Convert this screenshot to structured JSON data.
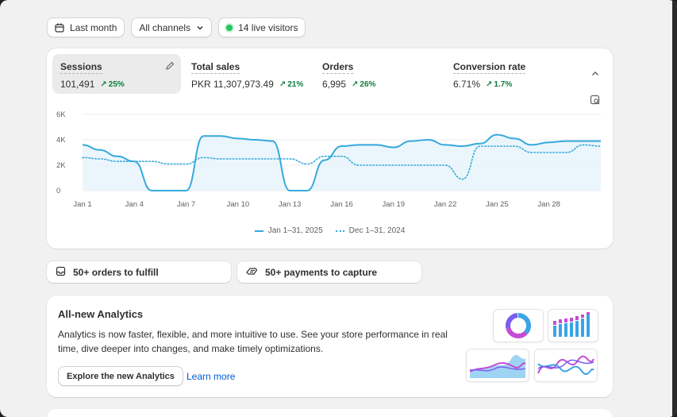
{
  "filters": {
    "date_range": "Last month",
    "channels": "All channels",
    "live_visitors": "14 live visitors"
  },
  "metrics": [
    {
      "label": "Sessions",
      "value": "101,491",
      "change": "25%",
      "selected": true
    },
    {
      "label": "Total sales",
      "value": "PKR 11,307,973.49",
      "change": "21%"
    },
    {
      "label": "Orders",
      "value": "6,995",
      "change": "26%"
    },
    {
      "label": "Conversion rate",
      "value": "6.71%",
      "change": "1.7%"
    }
  ],
  "chart_data": {
    "type": "line",
    "y_ticks": [
      "6K",
      "4K",
      "2K",
      "0"
    ],
    "ylim": [
      0,
      6000
    ],
    "x_ticks": [
      "Jan 1",
      "Jan 4",
      "Jan 7",
      "Jan 10",
      "Jan 13",
      "Jan 16",
      "Jan 19",
      "Jan 22",
      "Jan 25",
      "Jan 28"
    ],
    "x_days": [
      1,
      2,
      3,
      4,
      5,
      6,
      7,
      8,
      9,
      10,
      11,
      12,
      13,
      14,
      15,
      16,
      17,
      18,
      19,
      20,
      21,
      22,
      23,
      24,
      25,
      26,
      27,
      28,
      29,
      30,
      31
    ],
    "series": [
      {
        "name": "Jan 1–31, 2025",
        "style": "solid",
        "values": [
          3600,
          3200,
          2700,
          2300,
          0,
          0,
          0,
          4300,
          4300,
          4100,
          4000,
          3900,
          0,
          0,
          2400,
          3500,
          3600,
          3600,
          3400,
          3900,
          4000,
          3600,
          3500,
          3700,
          4400,
          4100,
          3600,
          3800,
          3900,
          3900,
          3900
        ]
      },
      {
        "name": "Dec 1–31, 2024",
        "style": "dotted",
        "values": [
          2600,
          2500,
          2300,
          2300,
          2300,
          2100,
          2100,
          2600,
          2500,
          2500,
          2500,
          2500,
          2500,
          2100,
          2700,
          2700,
          2000,
          2000,
          2000,
          2000,
          2000,
          2000,
          900,
          3500,
          3500,
          3500,
          3000,
          3000,
          3000,
          3600,
          3500
        ]
      }
    ],
    "colors": {
      "line": "#36a9dc",
      "fill": "#e8f4fb",
      "grid": "#ececec"
    }
  },
  "tasks": [
    {
      "label": "50+ orders to fulfill",
      "icon": "inbox-icon"
    },
    {
      "label": "50+ payments to capture",
      "icon": "payment-icon"
    }
  ],
  "promo": {
    "title": "All-new Analytics",
    "text": "Analytics is now faster, flexible, and more intuitive to use. See your store performance in real time, dive deeper into changes, and make timely optimizations.",
    "primary_button": "Explore the new Analytics",
    "link": "Learn more"
  }
}
